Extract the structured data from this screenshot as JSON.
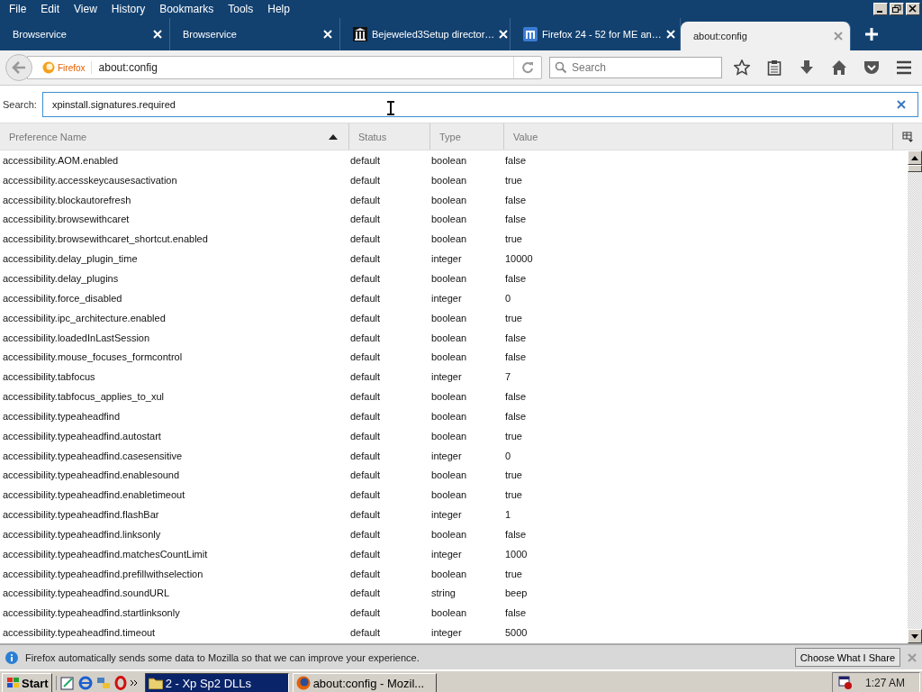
{
  "menu": [
    "File",
    "Edit",
    "View",
    "History",
    "Bookmarks",
    "Tools",
    "Help"
  ],
  "tabs": [
    {
      "label": "Browservice",
      "kind": "plain",
      "selected": false
    },
    {
      "label": "Browservice",
      "kind": "plain",
      "selected": false
    },
    {
      "label": "Bejeweled3Setup director…",
      "kind": "columns",
      "selected": false
    },
    {
      "label": "Firefox 24 - 52 for ME an…",
      "kind": "bars",
      "selected": false
    },
    {
      "label": "about:config",
      "kind": "plain",
      "selected": true
    }
  ],
  "toolbar": {
    "identity": "Firefox",
    "url": "about:config",
    "search_placeholder": "Search"
  },
  "filter": {
    "label": "Search:",
    "value": "xpinstall.signatures.required"
  },
  "table": {
    "columns": [
      "Preference Name",
      "Status",
      "Type",
      "Value"
    ],
    "rows": [
      {
        "name": "accessibility.AOM.enabled",
        "status": "default",
        "type": "boolean",
        "value": "false"
      },
      {
        "name": "accessibility.accesskeycausesactivation",
        "status": "default",
        "type": "boolean",
        "value": "true"
      },
      {
        "name": "accessibility.blockautorefresh",
        "status": "default",
        "type": "boolean",
        "value": "false"
      },
      {
        "name": "accessibility.browsewithcaret",
        "status": "default",
        "type": "boolean",
        "value": "false"
      },
      {
        "name": "accessibility.browsewithcaret_shortcut.enabled",
        "status": "default",
        "type": "boolean",
        "value": "true"
      },
      {
        "name": "accessibility.delay_plugin_time",
        "status": "default",
        "type": "integer",
        "value": "10000"
      },
      {
        "name": "accessibility.delay_plugins",
        "status": "default",
        "type": "boolean",
        "value": "false"
      },
      {
        "name": "accessibility.force_disabled",
        "status": "default",
        "type": "integer",
        "value": "0"
      },
      {
        "name": "accessibility.ipc_architecture.enabled",
        "status": "default",
        "type": "boolean",
        "value": "true"
      },
      {
        "name": "accessibility.loadedInLastSession",
        "status": "default",
        "type": "boolean",
        "value": "false"
      },
      {
        "name": "accessibility.mouse_focuses_formcontrol",
        "status": "default",
        "type": "boolean",
        "value": "false"
      },
      {
        "name": "accessibility.tabfocus",
        "status": "default",
        "type": "integer",
        "value": "7"
      },
      {
        "name": "accessibility.tabfocus_applies_to_xul",
        "status": "default",
        "type": "boolean",
        "value": "false"
      },
      {
        "name": "accessibility.typeaheadfind",
        "status": "default",
        "type": "boolean",
        "value": "false"
      },
      {
        "name": "accessibility.typeaheadfind.autostart",
        "status": "default",
        "type": "boolean",
        "value": "true"
      },
      {
        "name": "accessibility.typeaheadfind.casesensitive",
        "status": "default",
        "type": "integer",
        "value": "0"
      },
      {
        "name": "accessibility.typeaheadfind.enablesound",
        "status": "default",
        "type": "boolean",
        "value": "true"
      },
      {
        "name": "accessibility.typeaheadfind.enabletimeout",
        "status": "default",
        "type": "boolean",
        "value": "true"
      },
      {
        "name": "accessibility.typeaheadfind.flashBar",
        "status": "default",
        "type": "integer",
        "value": "1"
      },
      {
        "name": "accessibility.typeaheadfind.linksonly",
        "status": "default",
        "type": "boolean",
        "value": "false"
      },
      {
        "name": "accessibility.typeaheadfind.matchesCountLimit",
        "status": "default",
        "type": "integer",
        "value": "1000"
      },
      {
        "name": "accessibility.typeaheadfind.prefillwithselection",
        "status": "default",
        "type": "boolean",
        "value": "true"
      },
      {
        "name": "accessibility.typeaheadfind.soundURL",
        "status": "default",
        "type": "string",
        "value": "beep"
      },
      {
        "name": "accessibility.typeaheadfind.startlinksonly",
        "status": "default",
        "type": "boolean",
        "value": "false"
      },
      {
        "name": "accessibility.typeaheadfind.timeout",
        "status": "default",
        "type": "integer",
        "value": "5000"
      }
    ]
  },
  "notification": {
    "message": "Firefox automatically sends some data to Mozilla so that we can improve your experience.",
    "button": "Choose What I Share"
  },
  "taskbar": {
    "start": "Start",
    "tasks": [
      {
        "label": "2 - Xp Sp2 DLLs",
        "kind": "folder",
        "selected": true
      },
      {
        "label": "about:config - Mozil...",
        "kind": "browser",
        "selected": false
      }
    ],
    "clock": "1:27 AM"
  }
}
